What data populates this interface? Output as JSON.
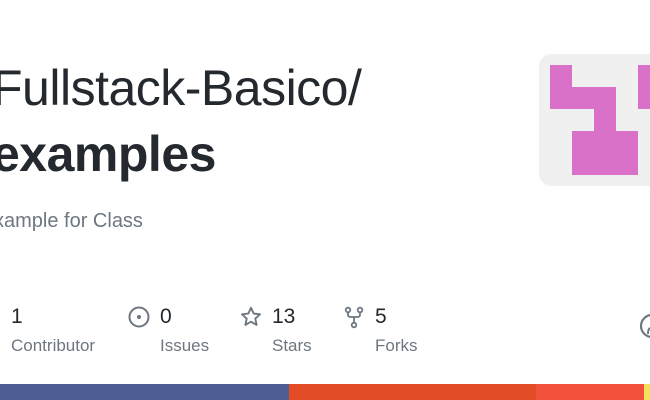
{
  "repo_card": {
    "owner": "Fullstack-Basico/",
    "name": "examples",
    "description": "xample for Class"
  },
  "stats": {
    "contributors": {
      "count": "1",
      "label": "Contributor",
      "icon": "people-icon"
    },
    "issues": {
      "count": "0",
      "label": "Issues",
      "icon": "issue-opened-icon"
    },
    "stars": {
      "count": "13",
      "label": "Stars",
      "icon": "star-icon"
    },
    "forks": {
      "count": "5",
      "label": "Forks",
      "icon": "repo-forked-icon"
    }
  },
  "avatar": {
    "icon": "identicon-avatar",
    "background": "#f0f0f0",
    "color": "#d971c9"
  },
  "language_bar": [
    {
      "color": "#4f5d95",
      "fraction": 0.445
    },
    {
      "color": "#e34c26",
      "fraction": 0.38
    },
    {
      "color": "#f1503b",
      "fraction": 0.165
    },
    {
      "color": "#f1e05a",
      "fraction": 0.01
    }
  ],
  "colors": {
    "title": "#24292f",
    "muted": "#6e7781"
  }
}
